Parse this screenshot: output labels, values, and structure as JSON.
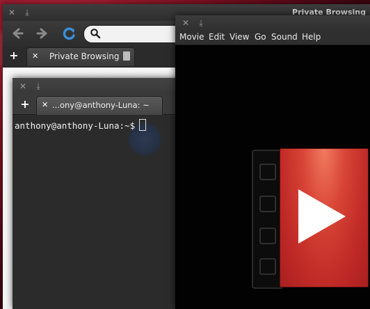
{
  "browser": {
    "window_title": "Private Browsing",
    "tab_label": "Private Browsing",
    "close_glyph": "✕",
    "download_glyph": "⤓"
  },
  "terminal": {
    "tab_label": "...ony@anthony-Luna: ~",
    "prompt": "anthony@anthony-Luna:~$",
    "close_glyph": "✕",
    "download_glyph": "⤓"
  },
  "totem": {
    "close_glyph": "✕",
    "download_glyph": "⤓",
    "menu": [
      "Movie",
      "Edit",
      "View",
      "Go",
      "Sound",
      "Help"
    ]
  },
  "icons": {
    "tab_add": "+",
    "tab_close": "✕",
    "back": "back-arrow-icon",
    "forward": "forward-arrow-icon",
    "reload": "reload-icon",
    "search": "search-icon",
    "page": "page-icon",
    "play": "play-icon"
  },
  "colors": {
    "desktop_red": "#7a1020",
    "reload_blue": "#3a8fd9",
    "play_red": "#d84435",
    "chrome_dark": "#2e2e2e"
  }
}
